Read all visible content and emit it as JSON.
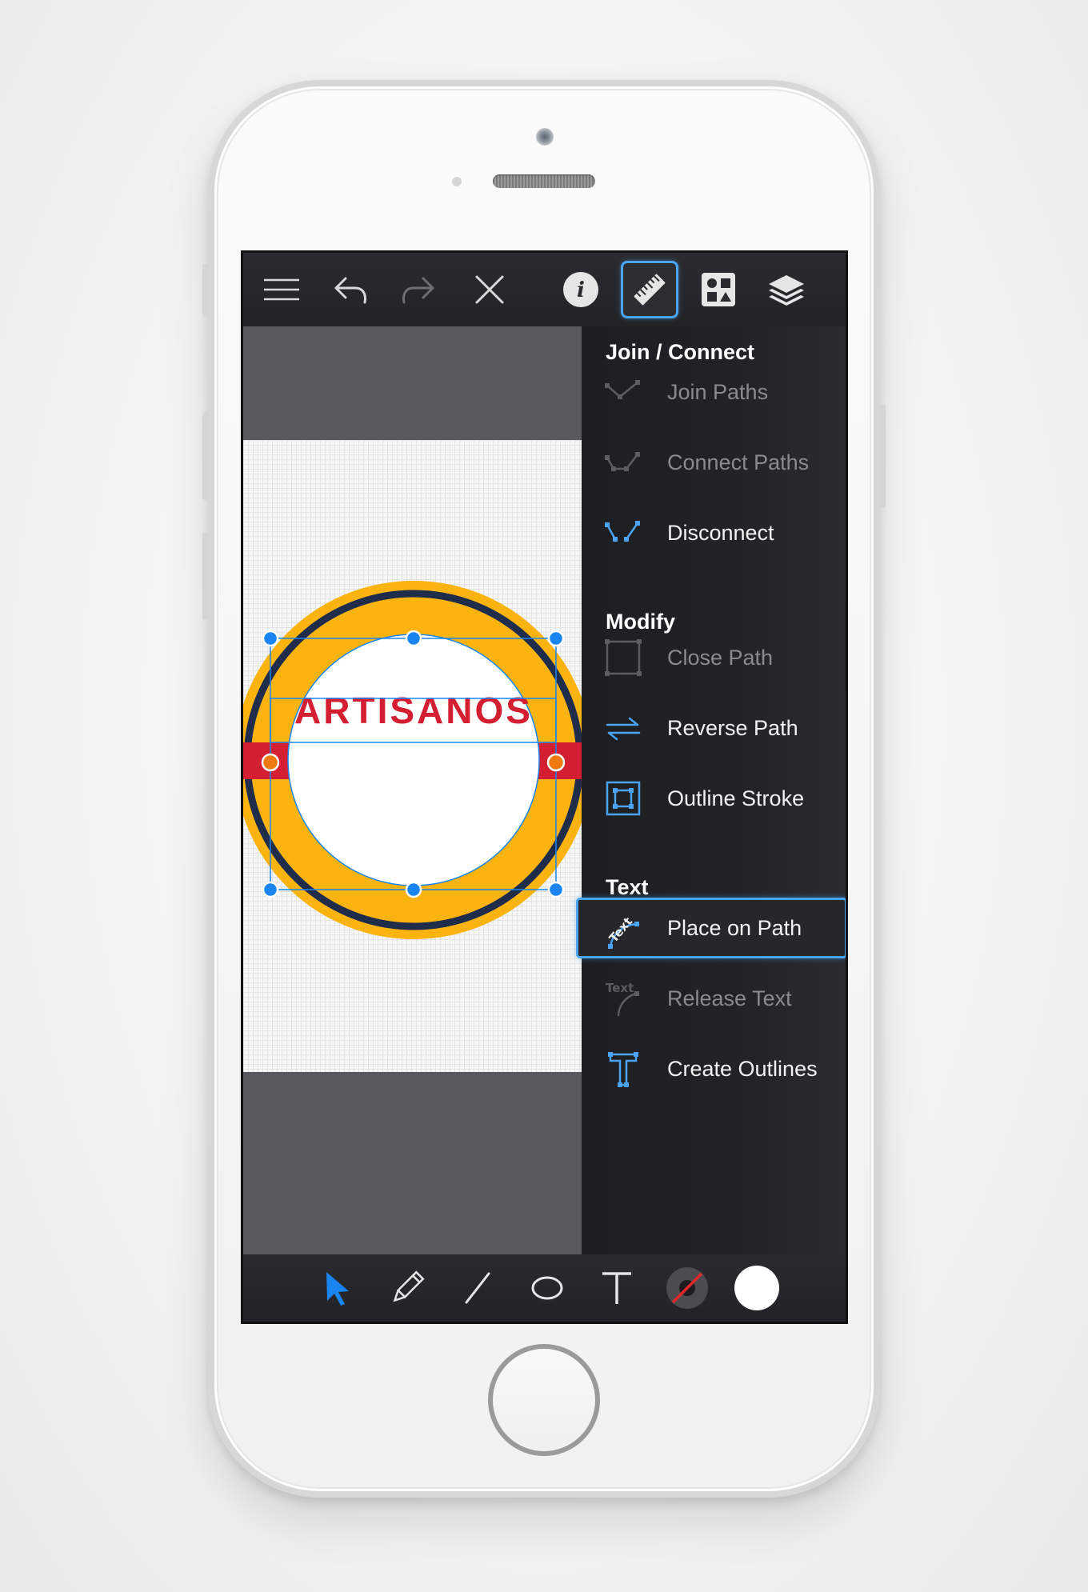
{
  "colors": {
    "accent": "#4aa3f5",
    "toolbar_bg": "#222326",
    "canvas_bg": "#58595d",
    "logo_yellow": "#fbb40f",
    "logo_navy": "#1f2c4a",
    "logo_red": "#d41f32",
    "handle_blue": "#1a85f0",
    "handle_orange": "#f07a12"
  },
  "toolbar": {
    "icons": [
      "menu-icon",
      "undo-icon",
      "redo-icon",
      "close-icon",
      "info-icon",
      "ruler-icon",
      "shapes-icon",
      "layers-icon"
    ],
    "active": "ruler-icon"
  },
  "canvas": {
    "logo_text": "ARTISANOS"
  },
  "panel": {
    "sections": {
      "join": {
        "title": "Join / Connect"
      },
      "modify": {
        "title": "Modify"
      },
      "text": {
        "title": "Text"
      }
    },
    "items": {
      "join_paths": {
        "label": "Join Paths",
        "enabled": false
      },
      "connect_paths": {
        "label": "Connect Paths",
        "enabled": false
      },
      "disconnect": {
        "label": "Disconnect",
        "enabled": true
      },
      "close_path": {
        "label": "Close Path",
        "enabled": false
      },
      "reverse_path": {
        "label": "Reverse Path",
        "enabled": true
      },
      "outline_stroke": {
        "label": "Outline Stroke",
        "enabled": true
      },
      "place_on_path": {
        "label": "Place on Path",
        "enabled": true,
        "selected": true,
        "icon_text": "Text"
      },
      "release_text": {
        "label": "Release Text",
        "enabled": false,
        "icon_text": "Text"
      },
      "create_outlines": {
        "label": "Create Outlines",
        "enabled": true
      }
    }
  },
  "bottom_toolbar": {
    "tools": [
      "select-arrow-icon",
      "pencil-icon",
      "line-icon",
      "ellipse-icon",
      "text-tool-icon",
      "stroke-color-swatch",
      "fill-color-swatch"
    ],
    "active": "select-arrow-icon",
    "fill_color": "#ffffff"
  }
}
